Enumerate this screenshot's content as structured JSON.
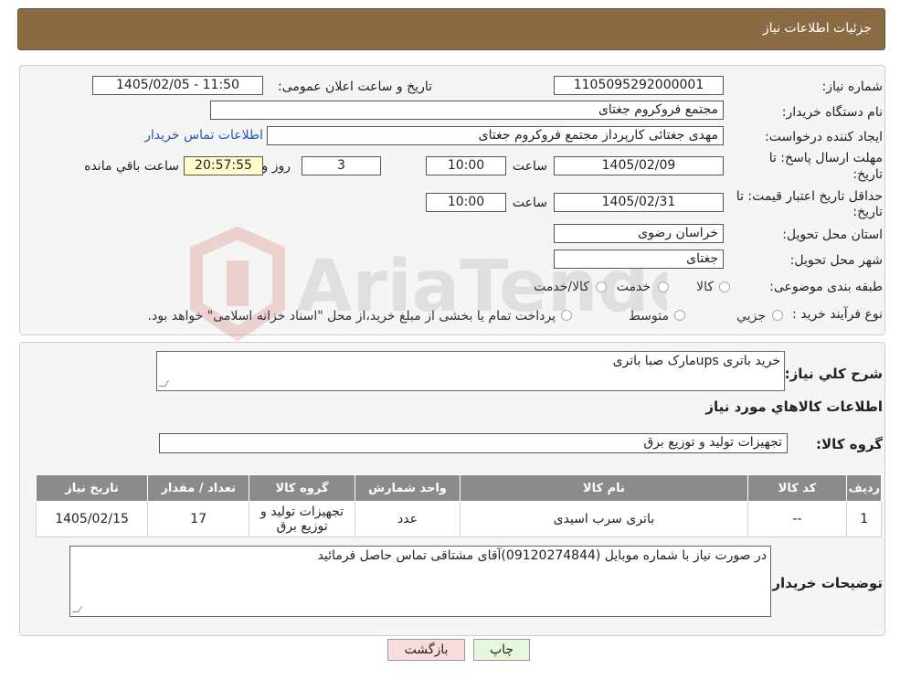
{
  "header": {
    "title": "جزئیات اطلاعات نیاز"
  },
  "form": {
    "need_number_label": "شماره نیاز:",
    "need_number": "1105095292000001",
    "announce_label": "تاریخ و ساعت اعلان عمومی:",
    "announce_value": "1405/02/05 - 11:50",
    "buyer_org_label": "نام دستگاه خریدار:",
    "buyer_org": "مجتمع فروکروم جغتای",
    "requester_label": "ایجاد کننده درخواست:",
    "requester": "مهدی جغتائی کارپرداز مجتمع فروکروم جغتای",
    "contact_link": "اطلاعات تماس خریدار",
    "deadline_label_1": "مهلت ارسال پاسخ: تا",
    "deadline_label_2": "تاریخ:",
    "deadline_date": "1405/02/09",
    "time_label": "ساعت",
    "deadline_time": "10:00",
    "days_value": "3",
    "days_label": "روز و",
    "remaining_time": "20:57:55",
    "remaining_label": "ساعت باقي مانده",
    "validity_label_1": "حداقل تاریخ اعتبار قیمت: تا",
    "validity_label_2": "تاریخ:",
    "validity_date": "1405/02/31",
    "validity_time": "10:00",
    "province_label": "استان محل تحویل:",
    "province": "خراسان رضوی",
    "city_label": "شهر محل تحویل:",
    "city": "جغتای",
    "category_label": "طبقه بندی موضوعی:",
    "category_options": [
      "کالا",
      "خدمت",
      "کالا/خدمت"
    ],
    "process_label": "نوع فرآیند خرید :",
    "process_options": [
      "جزيي",
      "متوسط"
    ],
    "process_note": "پرداخت تمام یا بخشی از مبلغ خرید،از محل \"اسناد خزانه اسلامی\" خواهد بود."
  },
  "summary": {
    "desc_label": "شرح کلي نياز:",
    "desc_value": "خرید باتری upsمارک صبا باتری",
    "items_title": "اطلاعات کالاهاي مورد نياز",
    "group_label": "گروه کالا:",
    "group_value": "تجهیزات تولید و توزیع برق"
  },
  "table": {
    "headers": [
      "رديف",
      "کد کالا",
      "نام کالا",
      "واحد شمارش",
      "گروه کالا",
      "تعداد / مقدار",
      "تاریخ نیاز"
    ],
    "rows": [
      [
        "1",
        "--",
        "باتری سرب اسیدی",
        "عدد",
        "تجهیزات تولید و توزیع برق",
        "17",
        "1405/02/15"
      ]
    ]
  },
  "buyer_notes": {
    "label": "توضیحات خریدار:",
    "value": "در صورت نیاز با شماره موبایل (09120274844)آقای مشتاقی تماس حاصل فرمائید"
  },
  "buttons": {
    "print": "چاپ",
    "back": "بازگشت"
  },
  "watermark": {
    "text": "AriaTender.neT"
  },
  "colors": {
    "header_bg": "#8b6b44",
    "link": "#2356b8",
    "table_header": "#8b8b8b",
    "back_btn": "#fadcdc",
    "print_btn": "#e6f7dc"
  }
}
